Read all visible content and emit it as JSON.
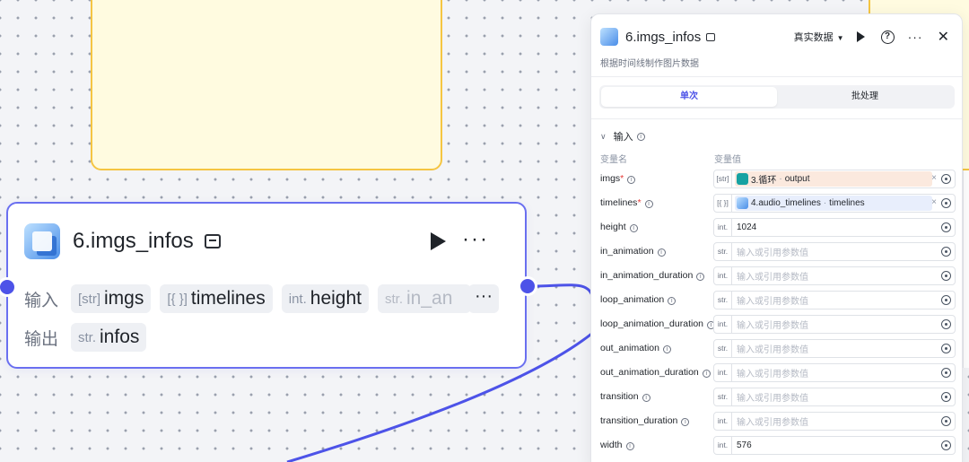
{
  "node": {
    "title": "6.imgs_infos",
    "input_label": "输入",
    "output_label": "输出",
    "inputs": [
      {
        "type": "[str]",
        "name": "imgs"
      },
      {
        "type": "[{ }]",
        "name": "timelines"
      },
      {
        "type": "int.",
        "name": "height"
      },
      {
        "type": "str.",
        "name": "in_an"
      }
    ],
    "outputs": [
      {
        "type": "str.",
        "name": "infos"
      }
    ],
    "more": "···"
  },
  "panel": {
    "title": "6.imgs_infos",
    "mode": "真实数据",
    "description": "根据时间线制作图片数据",
    "tabs": [
      "单次",
      "批处理"
    ],
    "section_title": "输入",
    "col_name": "变量名",
    "col_value": "变量值",
    "rows": [
      {
        "name": "imgs",
        "required": "*",
        "type": "[str]",
        "ref_node": "3.循环",
        "ref_output": "output"
      },
      {
        "name": "timelines",
        "required": "*",
        "type": "[{ }]",
        "ref_node": "4.audio_timelines",
        "ref_output": "timelines"
      },
      {
        "name": "height",
        "required": "",
        "type": "int.",
        "value": "1024"
      },
      {
        "name": "in_animation",
        "required": "",
        "type": "str.",
        "placeholder": "输入或引用参数值"
      },
      {
        "name": "in_animation_duration",
        "required": "",
        "type": "int.",
        "placeholder": "输入或引用参数值"
      },
      {
        "name": "loop_animation",
        "required": "",
        "type": "str.",
        "placeholder": "输入或引用参数值"
      },
      {
        "name": "loop_animation_duration",
        "required": "",
        "type": "int.",
        "placeholder": "输入或引用参数值"
      },
      {
        "name": "out_animation",
        "required": "",
        "type": "str.",
        "placeholder": "输入或引用参数值"
      },
      {
        "name": "out_animation_duration",
        "required": "",
        "type": "int.",
        "placeholder": "输入或引用参数值"
      },
      {
        "name": "transition",
        "required": "",
        "type": "str.",
        "placeholder": "输入或引用参数值"
      },
      {
        "name": "transition_duration",
        "required": "",
        "type": "int.",
        "placeholder": "输入或引用参数值"
      },
      {
        "name": "width",
        "required": "",
        "type": "int.",
        "value": "576"
      }
    ]
  },
  "colors": {
    "accent": "#4d53e8",
    "note_fill": "#fffbe0",
    "note_border": "#f5c542"
  }
}
